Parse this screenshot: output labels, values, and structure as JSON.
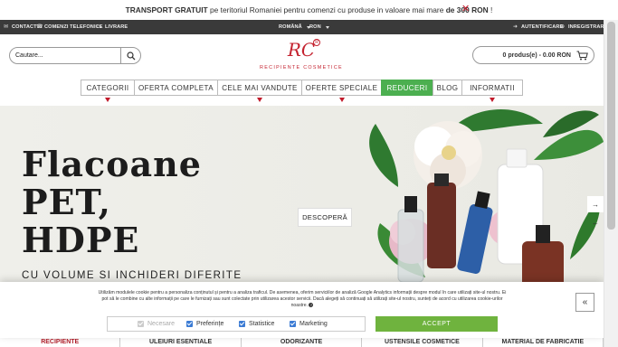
{
  "promo": {
    "bold_start": "TRANSPORT GRATUIT",
    "middle": " pe teritoriul Romaniei pentru comenzi cu produse in valoare mai mare ",
    "bold_end": "de 300 RON",
    "end": " !"
  },
  "topbar": {
    "contact": "CONTACT",
    "phones": "COMENZI TELEFONICE",
    "delivery": "LIVRARE",
    "language": "ROMÂNĂ",
    "currency": "RON",
    "login": "AUTENTIFICARE",
    "register": "INREGISTRARE"
  },
  "header": {
    "search_placeholder": "Cautare...",
    "logo_mark": "RC",
    "logo_sub": "RECIPIENTE COSMETICE",
    "cart_label": "0 produs(e) - 0.00 RON"
  },
  "nav": [
    "CATEGORII",
    "OFERTA COMPLETA",
    "CELE MAI VANDUTE",
    "OFERTE SPECIALE",
    "REDUCERI",
    "BLOG",
    "INFORMATII"
  ],
  "hero": {
    "line1": "Flacoane",
    "line2": "PET,",
    "line3": "HDPE",
    "subtitle": "CU VOLUME SI INCHIDERI DIFERITE",
    "cta": "DESCOPERĂ"
  },
  "cookie": {
    "text": "Utilizăm modulele cookie pentru a personaliza conținutul și pentru a analiza traficul. De asemenea, oferim serviciilor de analiză Google Analytics informații despre modul în care utilizați site-ul nostru. Ei pot să le combine cu alte informații pe care le furnizați sau sunt colectate prin utilizarea acestor servicii. Dacă alegeți să continuați să utilizați site-ul nostru, sunteți de acord cu utilizarea cookie-urilor noastre.",
    "opt_necessary": "Necesare",
    "opt_preferences": "Preferințe",
    "opt_statistics": "Statistice",
    "opt_marketing": "Marketing",
    "accept": "ACCEPT"
  },
  "categories": [
    "RECIPIENTE",
    "ULEIURI ESENTIALE",
    "ODORIZANTE",
    "USTENSILE COSMETICE",
    "MATERIAL DE FABRICATIE"
  ],
  "colors": {
    "brand_red": "#c4222f",
    "topbar_bg": "#3a3a3a",
    "reduceri_green": "#4caf50",
    "accept_green": "#6fb33e"
  }
}
